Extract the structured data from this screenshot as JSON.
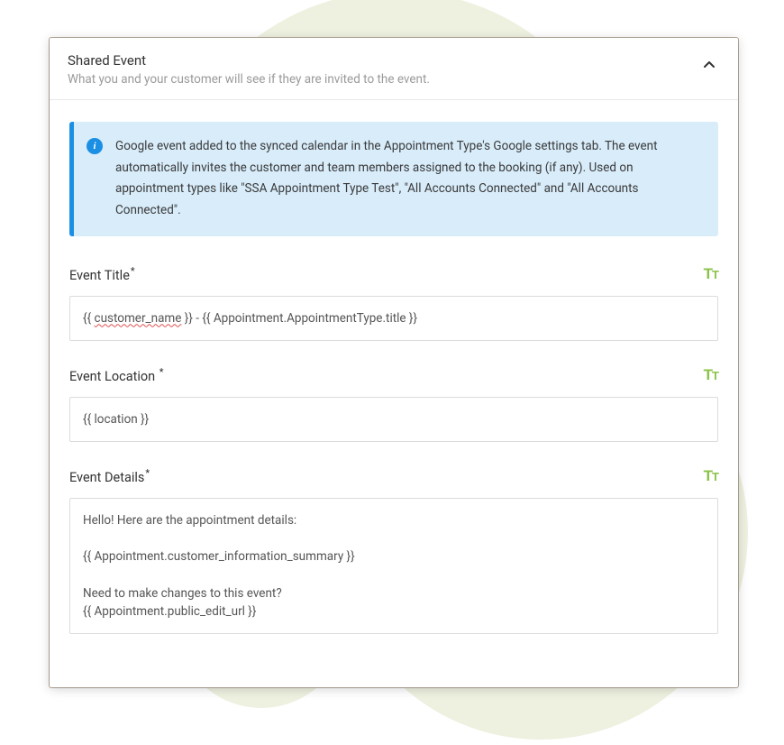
{
  "header": {
    "title": "Shared Event",
    "subtitle": "What you and your customer will see if they are invited to the event."
  },
  "info": {
    "icon_glyph": "i",
    "text": "Google event added to the synced calendar in the Appointment Type's Google settings tab. The event automatically invites the customer and team members assigned to the booking (if any). Used on appointment types like \"SSA Appointment Type Test\", \"All Accounts Connected\" and \"All Accounts Connected\"."
  },
  "fields": {
    "title": {
      "label": "Event Title",
      "required_mark": "*",
      "value_prefix": "{{ ",
      "value_spellcheck": "customer_name",
      "value_suffix": " }} - {{ Appointment.AppointmentType.title }}"
    },
    "location": {
      "label": "Event Location",
      "required_mark": "*",
      "value": "{{ location }}"
    },
    "details": {
      "label": "Event Details",
      "required_mark": "*",
      "value": "Hello! Here are the appointment details:\n\n{{ Appointment.customer_information_summary }}\n\nNeed to make changes to this event?\n{{ Appointment.public_edit_url }}"
    }
  }
}
